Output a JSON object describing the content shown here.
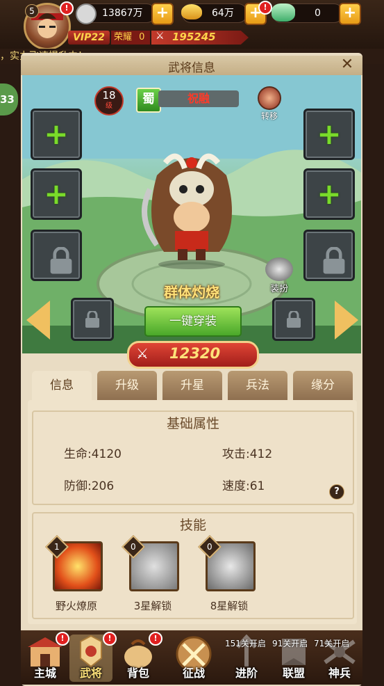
{
  "player": {
    "level": "5",
    "vip": "VIP22",
    "honor_label": "荣耀",
    "honor_value": "0",
    "power": "195245"
  },
  "resources": {
    "coin": "13867万",
    "gold": "64万",
    "jade": "0"
  },
  "marquee": "，实力飞速提升中！",
  "side_badge": "33",
  "panel": {
    "title": "武将信息"
  },
  "hero": {
    "level": "18",
    "level_label": "级",
    "faction": "蜀",
    "name": "祝融",
    "transfer_label": "转移",
    "skill_text": "群体灼烧",
    "equip_all_label": "一键穿装",
    "dress_label": "装扮",
    "power": "12320"
  },
  "tabs": [
    "信息",
    "升级",
    "升星",
    "兵法",
    "缘分"
  ],
  "base_attr": {
    "title": "基础属性",
    "hp_label": "生命:",
    "hp": "4120",
    "atk_label": "攻击:",
    "atk": "412",
    "def_label": "防御:",
    "def": "206",
    "spd_label": "速度:",
    "spd": "61",
    "help": "?"
  },
  "skills_section": {
    "title": "技能",
    "items": [
      {
        "level": "1",
        "name": "野火燎原"
      },
      {
        "level": "0",
        "name": "3星解锁"
      },
      {
        "level": "0",
        "name": "8星解锁"
      }
    ]
  },
  "nav": {
    "items": [
      {
        "label": "主城",
        "icon": "palace-icon"
      },
      {
        "label": "武将",
        "icon": "general-icon"
      },
      {
        "label": "背包",
        "icon": "bag-icon"
      },
      {
        "label": "征战",
        "icon": "battle-icon"
      },
      {
        "label": "进阶",
        "lock": "151关开启"
      },
      {
        "label": "联盟",
        "lock": "91关开启"
      },
      {
        "label": "神兵",
        "lock": "71关开启"
      }
    ]
  },
  "colors": {
    "accent_red": "#e02020",
    "gold": "#f5c344",
    "panel_bg": "#e9dcc3"
  }
}
